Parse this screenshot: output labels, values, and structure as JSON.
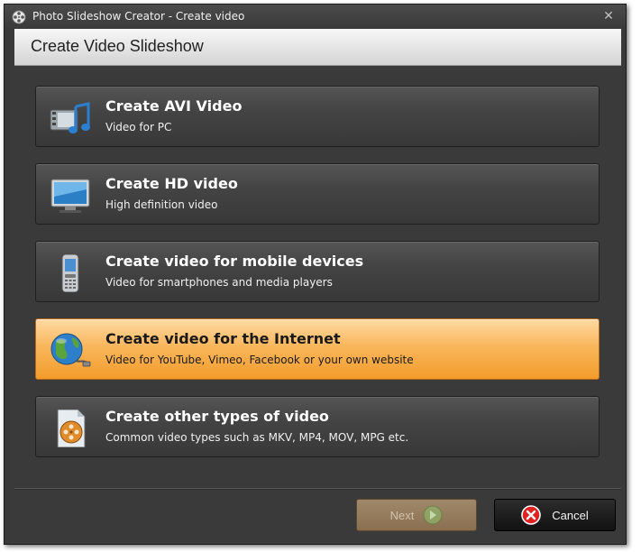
{
  "window": {
    "title": "Photo Slideshow Creator - Create video",
    "close_glyph": "✕"
  },
  "header": {
    "title": "Create Video Slideshow"
  },
  "options": [
    {
      "title": "Create AVI Video",
      "subtitle": "Video for PC",
      "icon": "film-music-icon",
      "active": false
    },
    {
      "title": "Create HD video",
      "subtitle": "High definition video",
      "icon": "hd-monitor-icon",
      "active": false
    },
    {
      "title": "Create video for mobile devices",
      "subtitle": "Video for smartphones and media players",
      "icon": "mobile-phone-icon",
      "active": false
    },
    {
      "title": "Create video for the Internet",
      "subtitle": "Video for YouTube, Vimeo, Facebook or your own website",
      "icon": "globe-icon",
      "active": true
    },
    {
      "title": "Create other types of video",
      "subtitle": "Common video types such as MKV, MP4, MOV, MPG etc.",
      "icon": "film-document-icon",
      "active": false
    }
  ],
  "buttons": {
    "next_label": "Next",
    "cancel_label": "Cancel"
  },
  "colors": {
    "active_accent": "#f9b75c",
    "background": "#3a3a3a"
  }
}
